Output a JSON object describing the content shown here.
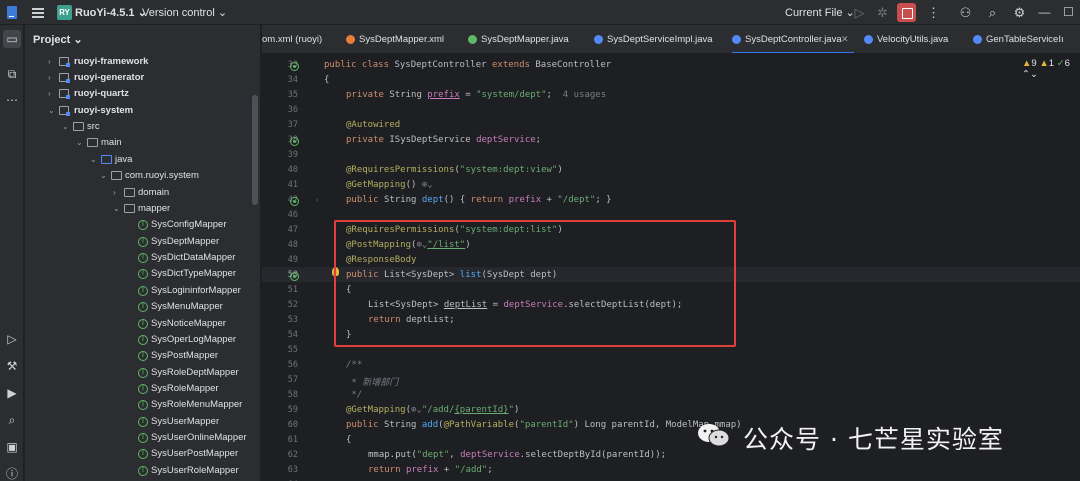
{
  "titlebar": {
    "project_badge": "RY",
    "project_name": "RuoYi-4.5.1",
    "vcs_label": "Version control",
    "run_config": "Current File"
  },
  "project_panel": {
    "header": "Project",
    "tree": [
      {
        "label": "ruoyi-framework",
        "bold": true
      },
      {
        "label": "ruoyi-generator",
        "bold": true
      },
      {
        "label": "ruoyi-quartz",
        "bold": true
      },
      {
        "label": "ruoyi-system",
        "bold": true
      },
      {
        "label": "src"
      },
      {
        "label": "main"
      },
      {
        "label": "java"
      },
      {
        "label": "com.ruoyi.system"
      },
      {
        "label": "domain"
      },
      {
        "label": "mapper"
      },
      {
        "label": "SysConfigMapper"
      },
      {
        "label": "SysDeptMapper"
      },
      {
        "label": "SysDictDataMapper"
      },
      {
        "label": "SysDictTypeMapper"
      },
      {
        "label": "SysLogininforMapper"
      },
      {
        "label": "SysMenuMapper"
      },
      {
        "label": "SysNoticeMapper"
      },
      {
        "label": "SysOperLogMapper"
      },
      {
        "label": "SysPostMapper"
      },
      {
        "label": "SysRoleDeptMapper"
      },
      {
        "label": "SysRoleMapper"
      },
      {
        "label": "SysRoleMenuMapper"
      },
      {
        "label": "SysUserMapper"
      },
      {
        "label": "SysUserOnlineMapper"
      },
      {
        "label": "SysUserPostMapper"
      },
      {
        "label": "SysUserRoleMapper"
      }
    ]
  },
  "tabs": [
    {
      "label": "om.xml (ruoyi)"
    },
    {
      "label": "SysDeptMapper.xml"
    },
    {
      "label": "SysDeptMapper.java"
    },
    {
      "label": "SysDeptServiceImpl.java"
    },
    {
      "label": "SysDeptController.java",
      "active": true
    },
    {
      "label": "VelocityUtils.java"
    },
    {
      "label": "GenTableServiceIı"
    }
  ],
  "inspections": {
    "warnings": "9",
    "infos": "1",
    "ok": "6"
  },
  "gutter": [
    "33",
    "34",
    "35",
    "36",
    "37",
    "38",
    "39",
    "40",
    "41",
    "42",
    "46",
    "47",
    "48",
    "49",
    "50",
    "51",
    "52",
    "53",
    "54",
    "55",
    "56",
    "57",
    "58",
    "59",
    "60",
    "61",
    "62",
    "63",
    "64"
  ],
  "code": {
    "l33_kw1": "public class ",
    "l33_name": "SysDeptController ",
    "l33_kw2": "extends ",
    "l33_base": "BaseController",
    "l34": "{",
    "l35_kw": "private ",
    "l35_type": "String ",
    "l35_field": "prefix",
    "l35_eq": " = ",
    "l35_str": "\"system/dept\"",
    "l35_semi": ";",
    "l35_hint": "  4 usages",
    "l37": "@Autowired",
    "l38_kw": "private ",
    "l38_type": "ISysDeptService ",
    "l38_field": "deptService",
    "l38_semi": ";",
    "l40_ann": "@RequiresPermissions",
    "l40_open": "(",
    "l40_str": "\"system:dept:view\"",
    "l40_close": ")",
    "l41_ann": "@GetMapping",
    "l41_rest": "()",
    "l42_kw": "public ",
    "l42_type": "String ",
    "l42_fn": "dept",
    "l42_p": "() ",
    "l42_brace1": "{ ",
    "l42_kw2": "return ",
    "l42_field": "prefix",
    "l42_plus": " + ",
    "l42_str": "\"/dept\"",
    "l42_end": "; }",
    "l47_ann": "@RequiresPermissions",
    "l47_open": "(",
    "l47_str": "\"system:dept:list\"",
    "l47_close": ")",
    "l48_ann": "@PostMapping",
    "l48_open": "(",
    "l48_str": "\"/list\"",
    "l48_close": ")",
    "l49_ann": "@ResponseBody",
    "l50_kw": "public ",
    "l50_type": "List<SysDept> ",
    "l50_fn": "list",
    "l50_params": "(SysDept dept)",
    "l51": "{",
    "l52_type": "List<SysDept> ",
    "l52_var": "deptList",
    "l52_eq": " = ",
    "l52_field": "deptService",
    "l52_call": ".selectDeptList(dept);",
    "l53_kw": "return ",
    "l53_var": "deptList;",
    "l54": "}",
    "l56": "/**",
    "l57": " * 新增部门",
    "l58": " */",
    "l59_ann": "@GetMapping",
    "l59_open": "(",
    "l59_str1": "\"/add/",
    "l59_var": "{parentId}",
    "l59_str2": "\"",
    "l59_close": ")",
    "l60_kw": "public ",
    "l60_type": "String ",
    "l60_fn": "add",
    "l60_open": "(",
    "l60_ann": "@PathVariable",
    "l60_p1": "(",
    "l60_str": "\"parentId\"",
    "l60_rest": ") Long parentId, ModelMap mmap)",
    "l61": "{",
    "l62_pre": "mmap.put(",
    "l62_str": "\"dept\"",
    "l62_comma": ", ",
    "l62_field": "deptService",
    "l62_rest": ".selectDeptById(parentId));",
    "l63_kw": "return ",
    "l63_field": "prefix",
    "l63_plus": " + ",
    "l63_str": "\"/add\"",
    "l63_semi": ";"
  },
  "watermark": "公众号 · 七芒星实验室",
  "colors": {
    "accent": "#3574f0",
    "highlight_box": "#e0403a",
    "stop_button": "#c94f4f"
  }
}
